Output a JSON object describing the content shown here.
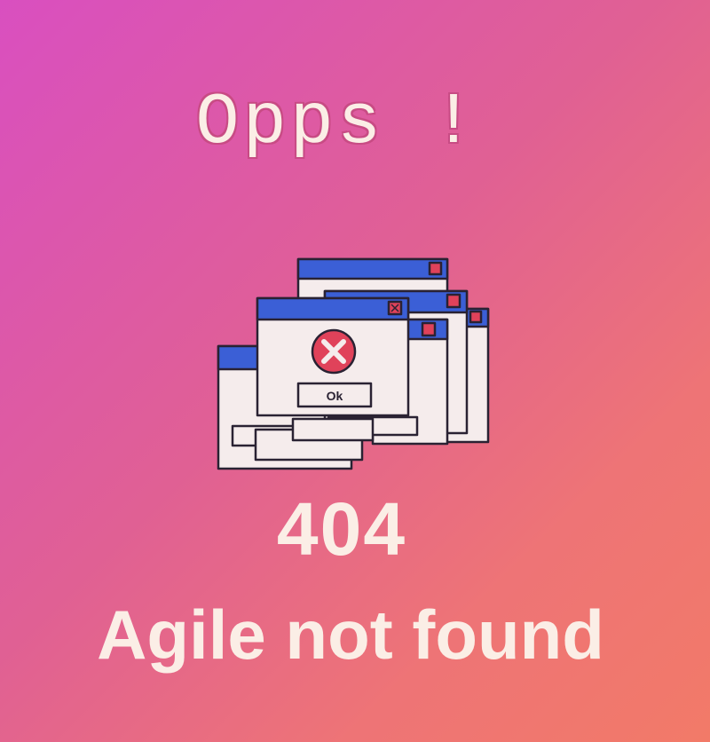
{
  "headline": "Opps !",
  "illustration": {
    "name": "stacked-error-dialogs",
    "icon": "error-x-icon",
    "button_label": "Ok",
    "colors": {
      "title_bar": "#3b5fd6",
      "window_body": "#f5ecec",
      "error_icon": "#e0425a",
      "close_box": "#e0425a"
    }
  },
  "error_code": "404",
  "message": "Agile not found",
  "colors": {
    "gradient_start": "#d94fc0",
    "gradient_end": "#f27a68",
    "text": "#fbeee6"
  }
}
